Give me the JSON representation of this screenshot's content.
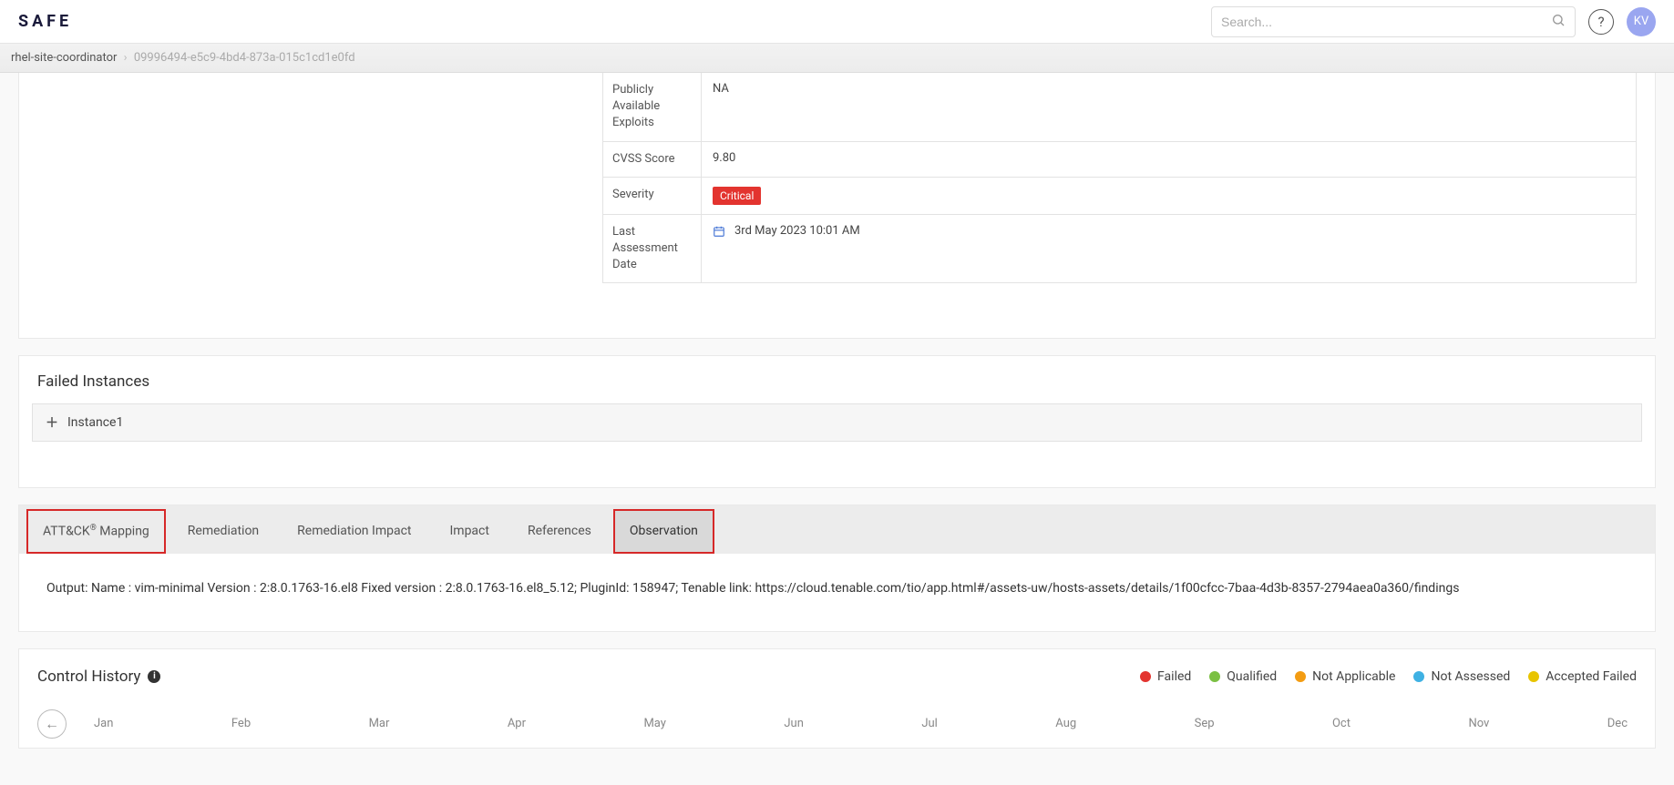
{
  "header": {
    "logo": "SAFE",
    "search_placeholder": "Search...",
    "avatar_initials": "KV"
  },
  "breadcrumb": {
    "primary": "rhel-site-coordinator",
    "secondary": "09996494-e5c9-4bd4-873a-015c1cd1e0fd"
  },
  "details": {
    "rows": [
      {
        "label": "Publicly Available Exploits",
        "value": "NA",
        "type": "text"
      },
      {
        "label": "CVSS Score",
        "value": "9.80",
        "type": "text"
      },
      {
        "label": "Severity",
        "value": "Critical",
        "type": "badge"
      },
      {
        "label": "Last Assessment Date",
        "value": "3rd May 2023 10:01 AM",
        "type": "date"
      }
    ]
  },
  "failed_instances": {
    "title": "Failed Instances",
    "items": [
      {
        "label": "Instance1"
      }
    ]
  },
  "tabs": {
    "items": [
      {
        "label_pre": "ATT&CK",
        "label_post": " Mapping",
        "has_reg": true
      },
      {
        "label": "Remediation"
      },
      {
        "label": "Remediation Impact"
      },
      {
        "label": "Impact"
      },
      {
        "label": "References"
      },
      {
        "label": "Observation"
      }
    ],
    "observation_content": "Output: Name : vim-minimal Version : 2:8.0.1763-16.el8 Fixed version : 2:8.0.1763-16.el8_5.12; PluginId: 158947; Tenable link: https://cloud.tenable.com/tio/app.html#/assets-uw/hosts-assets/details/1f00cfcc-7baa-4d3b-8357-2794aea0a360/findings"
  },
  "history": {
    "title": "Control History",
    "legend": [
      {
        "label": "Failed",
        "color": "#e3342f"
      },
      {
        "label": "Qualified",
        "color": "#7bc043"
      },
      {
        "label": "Not Applicable",
        "color": "#f39c12"
      },
      {
        "label": "Not Assessed",
        "color": "#3fb1e3"
      },
      {
        "label": "Accepted Failed",
        "color": "#e8c400"
      }
    ],
    "months": [
      "Jan",
      "Feb",
      "Mar",
      "Apr",
      "May",
      "Jun",
      "Jul",
      "Aug",
      "Sep",
      "Oct",
      "Nov",
      "Dec"
    ]
  }
}
